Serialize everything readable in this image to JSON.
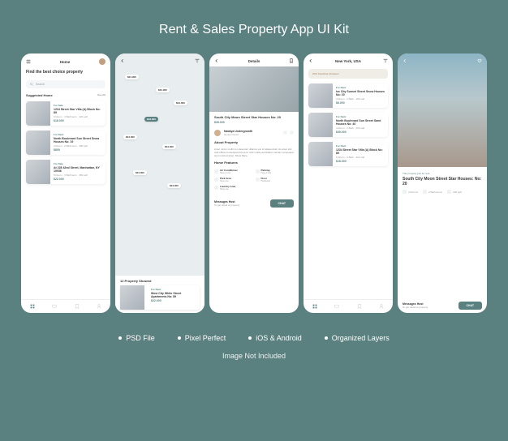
{
  "title": "Rent & Sales Property App UI Kit",
  "bullets": [
    "PSD File",
    "Pixel Perfect",
    "iOS & Android",
    "Organized Layers"
  ],
  "disclaimer": "Image Not Included",
  "colors": {
    "bg": "#5a8080",
    "accent": "#5a8080"
  },
  "screen1": {
    "header": "Home",
    "heading": "Find the best choice property",
    "search_placeholder": "Search",
    "section": "Suggested Home",
    "more": "See All",
    "cards": [
      {
        "tag": "For Sale",
        "title": "1234 Street Star Villa (A) Block No: 89",
        "meta": "6 Room  · 3 Bathroom  · 420 sqft",
        "price": "$18.000"
      },
      {
        "tag": "For Rent",
        "title": "North Boulevard Sun Street Snow Houses No: 19",
        "meta": "4 Room  ·  2 Bathroom  ·  280 sqft",
        "price": "$800"
      },
      {
        "tag": "For Sale",
        "title": "At 228 42nd Street, Manhattan, NY 10036",
        "meta": "5 Room  ·  3 Bathroom  ·  350 sqft",
        "price": "$22.000"
      }
    ]
  },
  "screen2": {
    "pins": [
      "$24.000",
      "$24.000",
      "$18.000",
      "$24.000",
      "$24.000",
      "$24.000",
      "$24.000",
      "$24.000"
    ],
    "count": "12 Property Showed",
    "card": {
      "tag": "For Rent",
      "title": "West City White Street Apartments No: 89",
      "price": "$22.000"
    }
  },
  "screen3": {
    "header": "Details",
    "title": "South City Moon Street Star Houses No: 20",
    "price": "$39.000",
    "agent_name": "Natalya Undergrowth",
    "agent_role": "House Owner",
    "about_label": "About Property",
    "about": "Amet minim mollit non deserunt ullamco est sit aliqua dolor do amet sint velit officia consequat duis enim velit mollit exercitation veniam consequat sunt nostrud amet. Show More",
    "features_label": "Home Features",
    "features": [
      {
        "name": "Air Conditioner",
        "sub": "Have 4 unit"
      },
      {
        "name": "Parking",
        "sub": "Have 2 slot"
      },
      {
        "name": "Park Area",
        "sub": "Have one"
      },
      {
        "name": "Floor",
        "sub": "Hardwood"
      },
      {
        "name": "Laundry Area",
        "sub": "Have one"
      }
    ],
    "cta_label": "Messages Host",
    "cta_sub": "To get detail of property",
    "cta_button": "CHAT"
  },
  "screen4": {
    "header": "New York, USA",
    "badge": "20% Sunshine Occasion",
    "tag_row": [
      "For Rent",
      "",
      ""
    ],
    "cards": [
      {
        "tag": "For Rent",
        "title": "Ice City Sunset Street Snow Houses No: 20",
        "meta": "3 Room · 2 Bath · 180 sqft",
        "price": "$6.000"
      },
      {
        "tag": "For Rent",
        "title": "North Boulevard Sun Street Sand Houses No: 40",
        "meta": "4 Room · 2 Bath · 260 sqft",
        "price": "$39.000"
      },
      {
        "tag": "For Rent",
        "title": "1234 Street Star Villa (A) Block No: 89",
        "meta": "6 Room · 3 Bath · 420 sqft",
        "price": "$18.000"
      }
    ]
  },
  "screen5": {
    "rent_note": "This property just for rent",
    "title": "South City Moon Street Star Houses: No: 20",
    "meta": [
      {
        "icon": "bed-icon",
        "text": "4 Rooms"
      },
      {
        "icon": "bath-icon",
        "text": "2 Bathrooms"
      },
      {
        "icon": "area-icon",
        "text": "200 sqft"
      }
    ],
    "cta_label": "Messages Host",
    "cta_sub": "To get detail of property",
    "cta_button": "CHAT"
  }
}
